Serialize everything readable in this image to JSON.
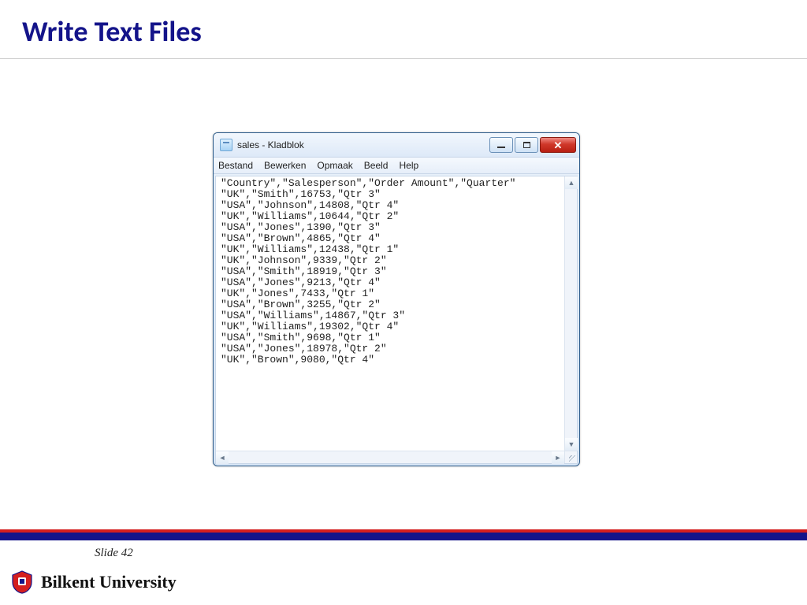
{
  "slide": {
    "title": "Write Text Files",
    "number_label": "Slide 42",
    "university": "Bilkent University"
  },
  "window": {
    "title": "sales - Kladblok",
    "menus": {
      "file": "Bestand",
      "edit": "Bewerken",
      "format": "Opmaak",
      "view": "Beeld",
      "help": "Help"
    },
    "content": "\"Country\",\"Salesperson\",\"Order Amount\",\"Quarter\"\n\"UK\",\"Smith\",16753,\"Qtr 3\"\n\"USA\",\"Johnson\",14808,\"Qtr 4\"\n\"UK\",\"Williams\",10644,\"Qtr 2\"\n\"USA\",\"Jones\",1390,\"Qtr 3\"\n\"USA\",\"Brown\",4865,\"Qtr 4\"\n\"UK\",\"Williams\",12438,\"Qtr 1\"\n\"UK\",\"Johnson\",9339,\"Qtr 2\"\n\"USA\",\"Smith\",18919,\"Qtr 3\"\n\"USA\",\"Jones\",9213,\"Qtr 4\"\n\"UK\",\"Jones\",7433,\"Qtr 1\"\n\"USA\",\"Brown\",3255,\"Qtr 2\"\n\"USA\",\"Williams\",14867,\"Qtr 3\"\n\"UK\",\"Williams\",19302,\"Qtr 4\"\n\"USA\",\"Smith\",9698,\"Qtr 1\"\n\"USA\",\"Jones\",18978,\"Qtr 2\"\n\"UK\",\"Brown\",9080,\"Qtr 4\""
  }
}
